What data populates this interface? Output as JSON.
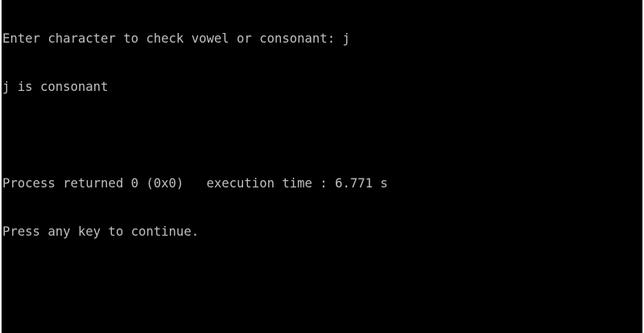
{
  "console": {
    "lines": [
      "Enter character to check vowel or consonant: j",
      "j is consonant",
      "",
      "Process returned 0 (0x0)   execution time : 6.771 s",
      "Press any key to continue."
    ],
    "colors": {
      "background": "#000000",
      "text": "#c0c0c0"
    }
  }
}
